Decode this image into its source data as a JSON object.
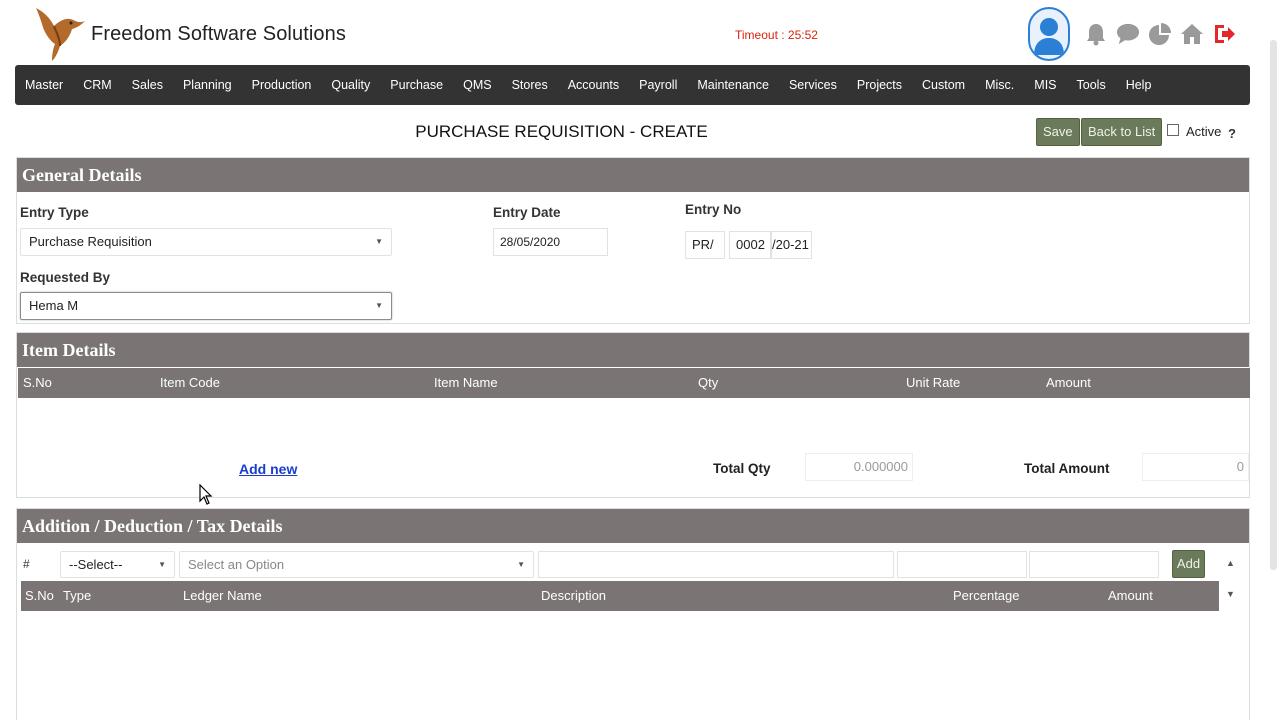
{
  "header": {
    "company": "Freedom Software Solutions",
    "timeout": "Timeout : 25:52",
    "icons": [
      "user-avatar-icon",
      "bell-icon",
      "chat-icon",
      "pie-chart-icon",
      "home-icon",
      "logout-icon"
    ]
  },
  "menu": [
    "Master",
    "CRM",
    "Sales",
    "Planning",
    "Production",
    "Quality",
    "Purchase",
    "QMS",
    "Stores",
    "Accounts",
    "Payroll",
    "Maintenance",
    "Services",
    "Projects",
    "Custom",
    "Misc.",
    "MIS",
    "Tools",
    "Help"
  ],
  "toolbar": {
    "title": "PURCHASE REQUISITION - CREATE",
    "save": "Save",
    "back": "Back to List",
    "active": "Active",
    "help": "?"
  },
  "general": {
    "heading": "General Details",
    "entry_type_label": "Entry Type",
    "entry_type_value": "Purchase Requisition",
    "entry_date_label": "Entry Date",
    "entry_date_value": "28/05/2020",
    "entry_no_label": "Entry No",
    "entry_no_prefix": "PR/",
    "entry_no_number": "0002",
    "entry_no_suffix": "/20-21",
    "requested_by_label": "Requested By",
    "requested_by_value": "Hema M"
  },
  "items": {
    "heading": "Item Details",
    "columns": [
      "S.No",
      "Item Code",
      "Item Name",
      "Qty",
      "Unit Rate",
      "Amount"
    ],
    "add_new": "Add new",
    "total_qty_label": "Total Qty",
    "total_qty_value": "0.000000",
    "total_amount_label": "Total Amount",
    "total_amount_value": "0"
  },
  "tax": {
    "heading": "Addition / Deduction / Tax Details",
    "hash": "#",
    "type_select": "--Select--",
    "ledger_placeholder": "Select an Option",
    "add": "Add",
    "columns": [
      "S.No",
      "Type",
      "Ledger Name",
      "Description",
      "Percentage",
      "Amount"
    ]
  },
  "colors": {
    "menubar": "#333333",
    "panel_header": "#7a7474",
    "button": "#6a7a5b",
    "timeout": "#d9230f",
    "link": "#1a3dcc"
  }
}
